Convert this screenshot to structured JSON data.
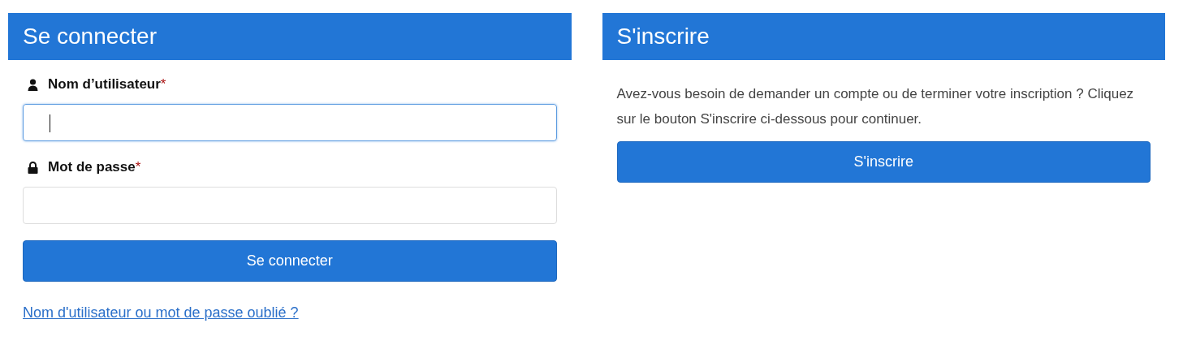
{
  "login": {
    "title": "Se connecter",
    "fields": [
      {
        "kind": "user",
        "label": "Nom d’utilisateur",
        "required_mark": "*",
        "focused": true
      },
      {
        "kind": "password",
        "label": "Mot de passe",
        "required_mark": "*",
        "focused": false
      }
    ],
    "button": "Se connecter",
    "forgot_link": "Nom d'utilisateur ou mot de passe oublié ?"
  },
  "register": {
    "title": "S'inscrire",
    "text": "Avez-vous besoin de demander un compte ou de terminer votre inscription ? Cliquez sur le bouton S'inscrire ci-dessous pour continuer.",
    "button": "S'inscrire"
  }
}
